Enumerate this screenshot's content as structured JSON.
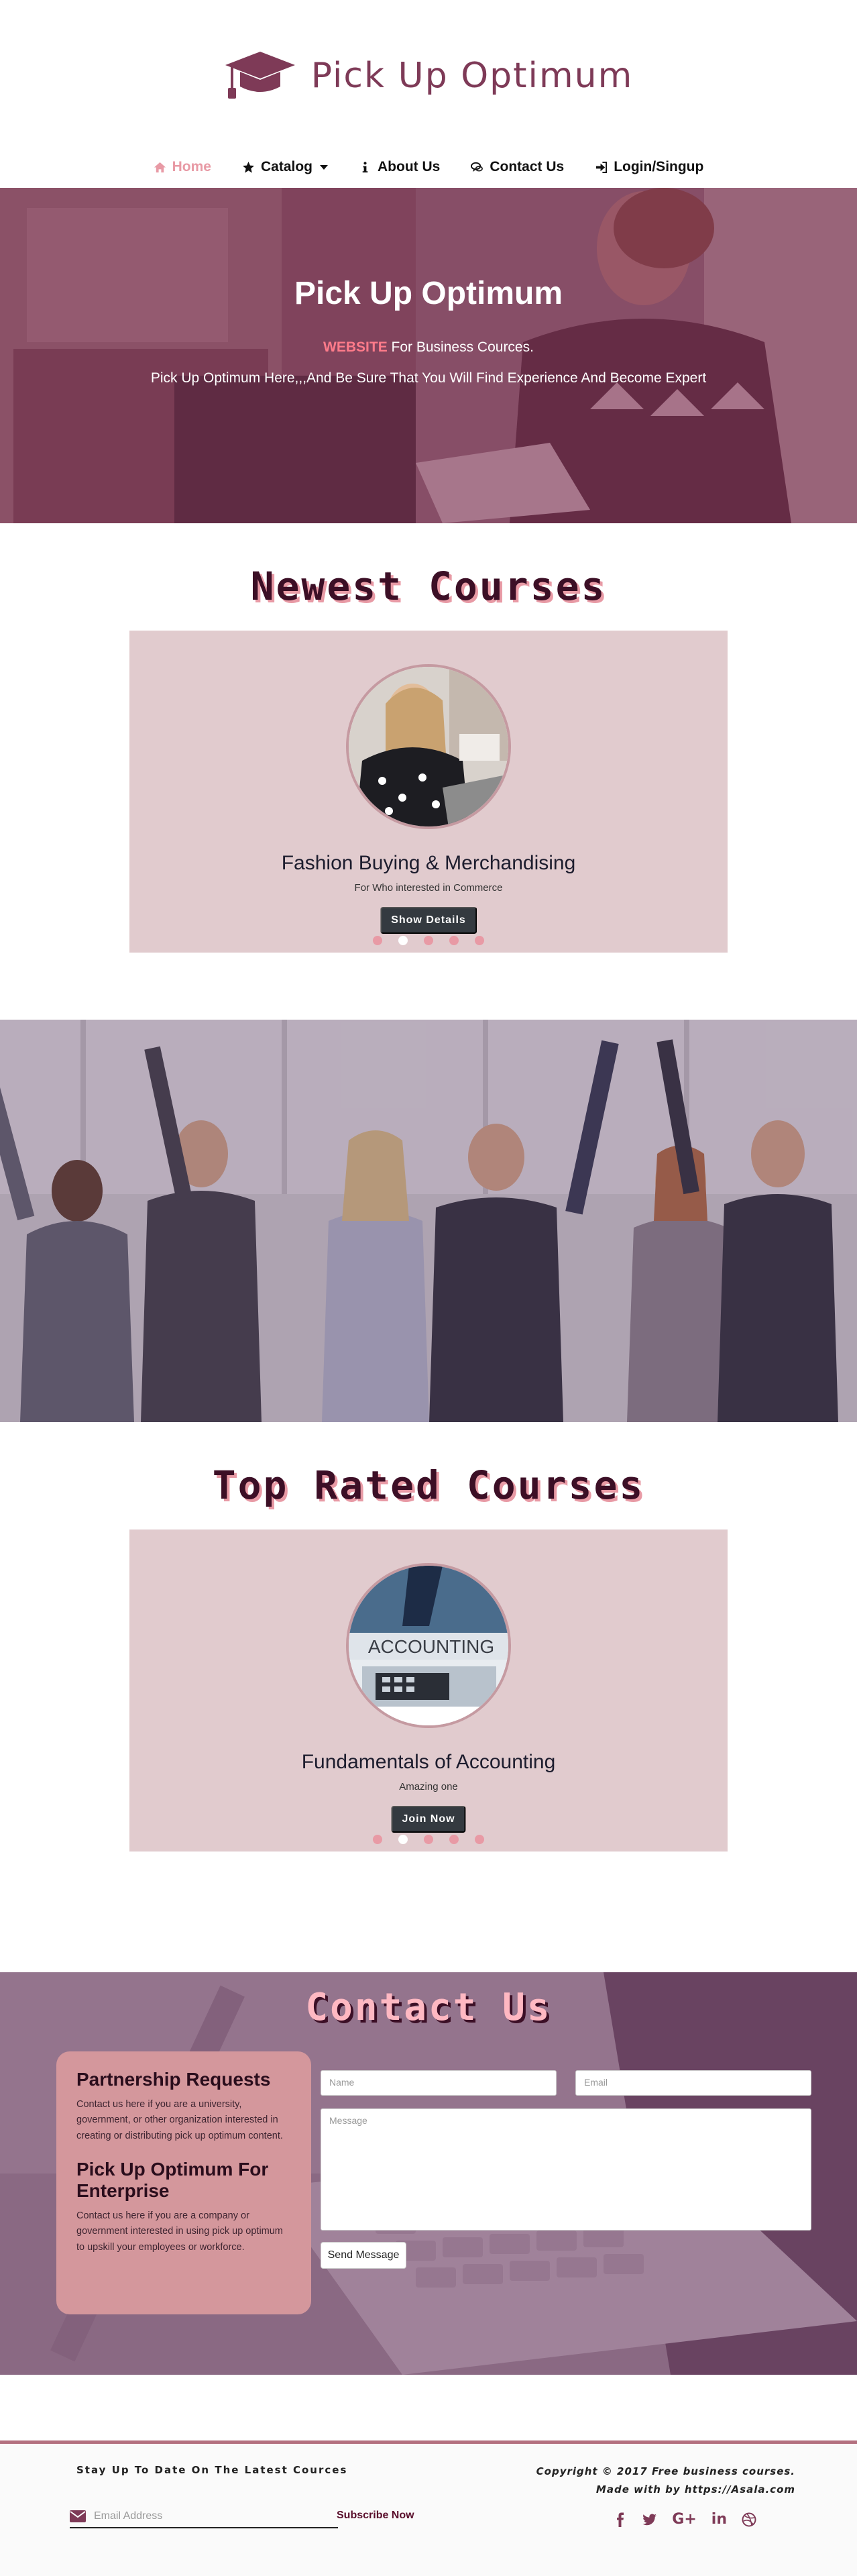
{
  "brand": {
    "title": "Pick Up Optimum"
  },
  "nav": {
    "items": [
      {
        "label": "Home",
        "icon": "home-icon"
      },
      {
        "label": "Catalog",
        "icon": "star-icon"
      },
      {
        "label": "About Us",
        "icon": "info-icon"
      },
      {
        "label": "Contact Us",
        "icon": "chat-icon"
      },
      {
        "label": "Login/Singup",
        "icon": "sign-in-icon"
      }
    ]
  },
  "hero": {
    "title": "Pick Up Optimum",
    "subtitle_accent": "WEBSITE",
    "subtitle_rest": " For Business Cources.",
    "description": "Pick Up Optimum Here,,,And Be Sure That You Will Find Experience And Become Expert"
  },
  "newest": {
    "section_title": "Newest Courses",
    "course_name": "Fashion Buying & Merchandising",
    "course_desc": "For Who interested in Commerce",
    "button_label": "Show Details",
    "active_slide": 2,
    "slide_count": 5
  },
  "top_rated": {
    "section_title": "Top Rated Courses",
    "image_text": "ACCOUNTING",
    "course_name": "Fundamentals of Accounting",
    "course_desc": "Amazing one",
    "button_label": "Join Now",
    "active_slide": 2,
    "slide_count": 5
  },
  "contact": {
    "section_title": "Contact Us",
    "partnership_title": "Partnership Requests",
    "partnership_text": "Contact us here if you are a university, government, or other organization interested in creating or distributing pick up optimum content.",
    "enterprise_title": "Pick Up Optimum For Enterprise",
    "enterprise_text": "Contact us here if you are a company or government interested in using pick up optimum to upskill your employees or workforce.",
    "name_placeholder": "Name",
    "email_placeholder": "Email",
    "message_placeholder": "Message",
    "send_label": "Send Message"
  },
  "footer": {
    "newsletter_title": "Stay Up To Date On The Latest Cources",
    "email_placeholder": "Email Address",
    "subscribe_label": "Subscribe Now",
    "copyright_line1": "Copyright © 2017 Free business courses.",
    "copyright_line2": "Made with  by https://Asala.com",
    "social": [
      "facebook-icon",
      "twitter-icon",
      "google-plus-icon",
      "linkedin-icon",
      "dribbble-icon"
    ]
  },
  "colors": {
    "brand": "#7e3a57",
    "accent_pink": "#e89aa5",
    "card_bg": "#e1cbce",
    "dark_title": "#3c0f26",
    "info_box": "#d4979c"
  }
}
